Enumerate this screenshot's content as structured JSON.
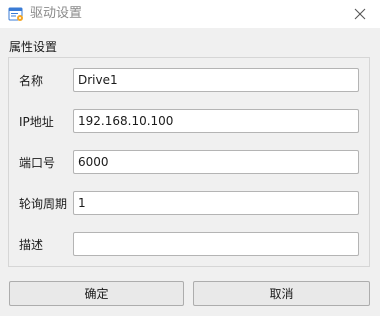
{
  "window": {
    "title": "驱动设置",
    "app_icon": "settings-window-icon",
    "close_icon": "close-icon"
  },
  "group": {
    "title": "属性设置"
  },
  "fields": [
    {
      "label": "名称",
      "value": "Drive1"
    },
    {
      "label": "IP地址",
      "value": "192.168.10.100"
    },
    {
      "label": "端口号",
      "value": "6000"
    },
    {
      "label": "轮询周期",
      "value": "1"
    },
    {
      "label": "描述",
      "value": ""
    }
  ],
  "buttons": {
    "ok": "确定",
    "cancel": "取消"
  },
  "colors": {
    "window_background": "#f0f0f0",
    "titlebar_background": "#ffffff",
    "title_text": "#8a8a8a",
    "icon_blue": "#3a7bd5",
    "input_border": "#b4b4b4",
    "button_background": "#e9e9e9"
  }
}
